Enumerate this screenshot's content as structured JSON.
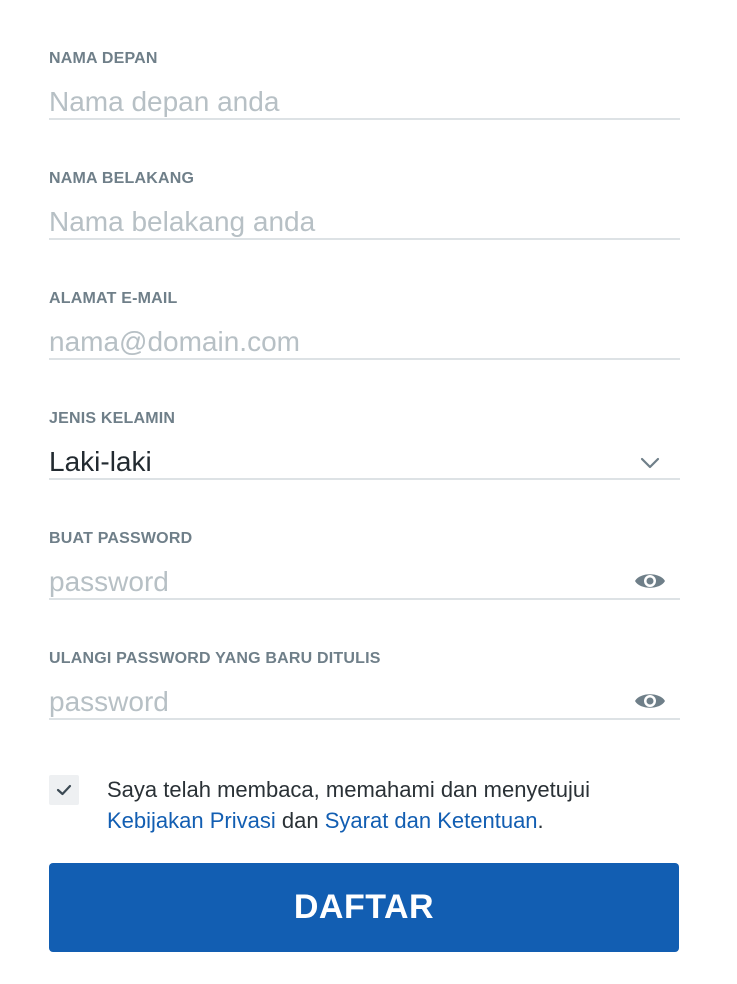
{
  "fields": {
    "first_name": {
      "label": "NAMA DEPAN",
      "value": "",
      "placeholder": "Nama depan anda"
    },
    "last_name": {
      "label": "NAMA BELAKANG",
      "value": "",
      "placeholder": "Nama belakang anda"
    },
    "email": {
      "label": "ALAMAT E-MAIL",
      "value": "",
      "placeholder": "nama@domain.com"
    },
    "gender": {
      "label": "JENIS KELAMIN",
      "selected": "Laki-laki",
      "icon": "chevron-down-icon"
    },
    "password": {
      "label": "BUAT PASSWORD",
      "value": "",
      "placeholder": "password",
      "icon": "eye-icon"
    },
    "password_confirm": {
      "label": "ULANGI PASSWORD YANG BARU DITULIS",
      "value": "",
      "placeholder": "password",
      "icon": "eye-icon"
    }
  },
  "consent": {
    "checked": true,
    "text_before": "Saya telah membaca, memahami dan menyetujui",
    "privacy_link": "Kebijakan Privasi",
    "joiner": "dan",
    "terms_link": "Syarat dan Ketentuan",
    "text_after": "."
  },
  "submit": {
    "label": "DAFTAR"
  },
  "colors": {
    "primary": "#125eb2",
    "label": "#6f7f89",
    "placeholder": "#b7c0c5",
    "divider": "#dde2e5",
    "text": "#222a30"
  }
}
